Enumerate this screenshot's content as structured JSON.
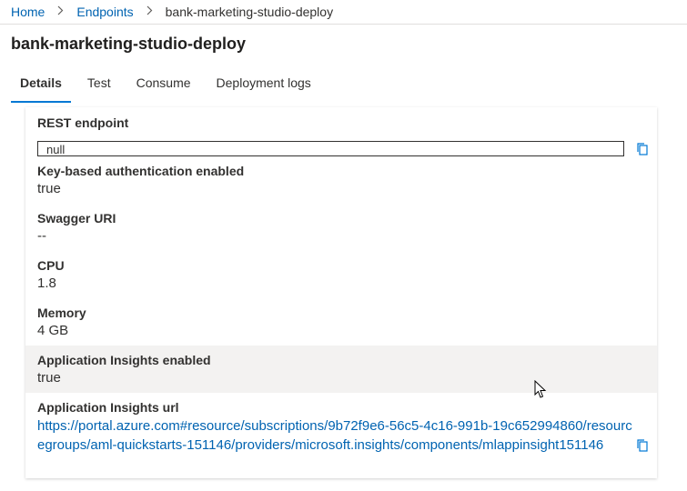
{
  "breadcrumb": {
    "home": "Home",
    "endpoints": "Endpoints",
    "current": "bank-marketing-studio-deploy",
    "separator": ">"
  },
  "page": {
    "title": "bank-marketing-studio-deploy"
  },
  "tabs": [
    {
      "label": "Details",
      "active": true
    },
    {
      "label": "Test",
      "active": false
    },
    {
      "label": "Consume",
      "active": false
    },
    {
      "label": "Deployment logs",
      "active": false
    }
  ],
  "details": {
    "rest_endpoint": {
      "label": "REST endpoint",
      "value": "null"
    },
    "key_auth": {
      "label": "Key-based authentication enabled",
      "value": "true"
    },
    "swagger": {
      "label": "Swagger URI",
      "value": "--"
    },
    "cpu": {
      "label": "CPU",
      "value": "1.8"
    },
    "memory": {
      "label": "Memory",
      "value": "4 GB"
    },
    "app_insights_enabled": {
      "label": "Application Insights enabled",
      "value": "true"
    },
    "app_insights_url": {
      "label": "Application Insights url",
      "value": "https://portal.azure.com#resource/subscriptions/9b72f9e6-56c5-4c16-991b-19c652994860/resourcegroups/aml-quickstarts-151146/providers/microsoft.insights/components/mlappinsight151146"
    }
  },
  "colors": {
    "link": "#0063b1",
    "accent": "#0078d4",
    "text": "#323130",
    "highlight_row": "#f3f2f1"
  },
  "icons": {
    "copy": "copy-icon",
    "chevron": "chevron-right-icon",
    "cursor": "mouse-pointer-icon"
  }
}
